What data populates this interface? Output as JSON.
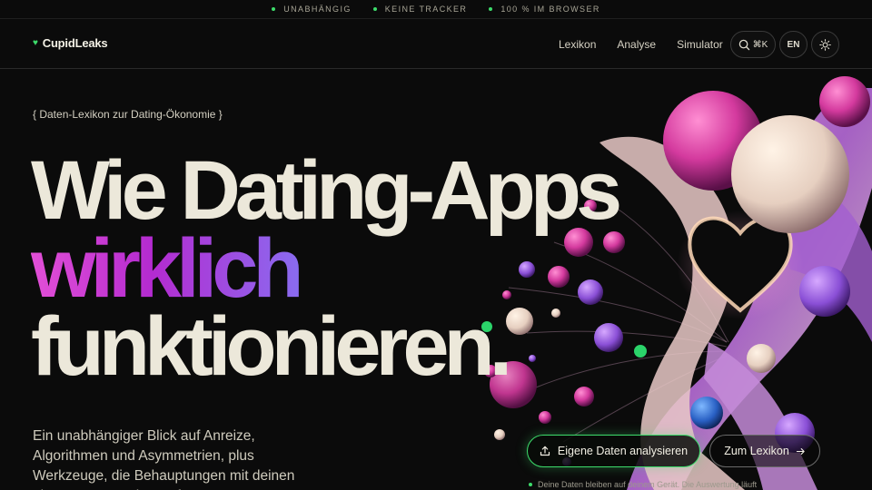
{
  "topbar": {
    "items": [
      "UNABHÄNGIG",
      "KEINE TRACKER",
      "100 % IM BROWSER"
    ]
  },
  "brand": {
    "name": "CupidLeaks",
    "icon": "heart-icon",
    "accent": "#3ddc6b"
  },
  "nav": {
    "links": [
      "Lexikon",
      "Analyse",
      "Simulator"
    ],
    "search_shortcut": "⌘K",
    "language": "EN",
    "theme_icon": "sun-icon"
  },
  "hero": {
    "eyebrow": "{ Daten-Lexikon zur Dating-Ökonomie }",
    "headline_1": "Wie Dating-Apps",
    "headline_2": "wirklich",
    "headline_3": "funktionieren.",
    "lead": "Ein unabhängiger Blick auf Anreize, Algorithmen und Asymmetrien, plus Werkzeuge, die Behauptungen mit deinen eigenen Daten überprüfen.",
    "cta_primary": "Eigene Daten analysieren",
    "cta_primary_icon": "upload-icon",
    "cta_secondary": "Zum Lexikon",
    "cta_secondary_icon": "arrow-right-icon",
    "note": "Deine Daten bleiben auf deinem Gerät. Die Auswertung läuft"
  },
  "colors": {
    "background": "#0b0b0b",
    "text": "#ece8da",
    "accent_green": "#3ddc6b",
    "gradient": [
      "#e24fd6",
      "#b42bd0",
      "#8a6bf0"
    ]
  }
}
